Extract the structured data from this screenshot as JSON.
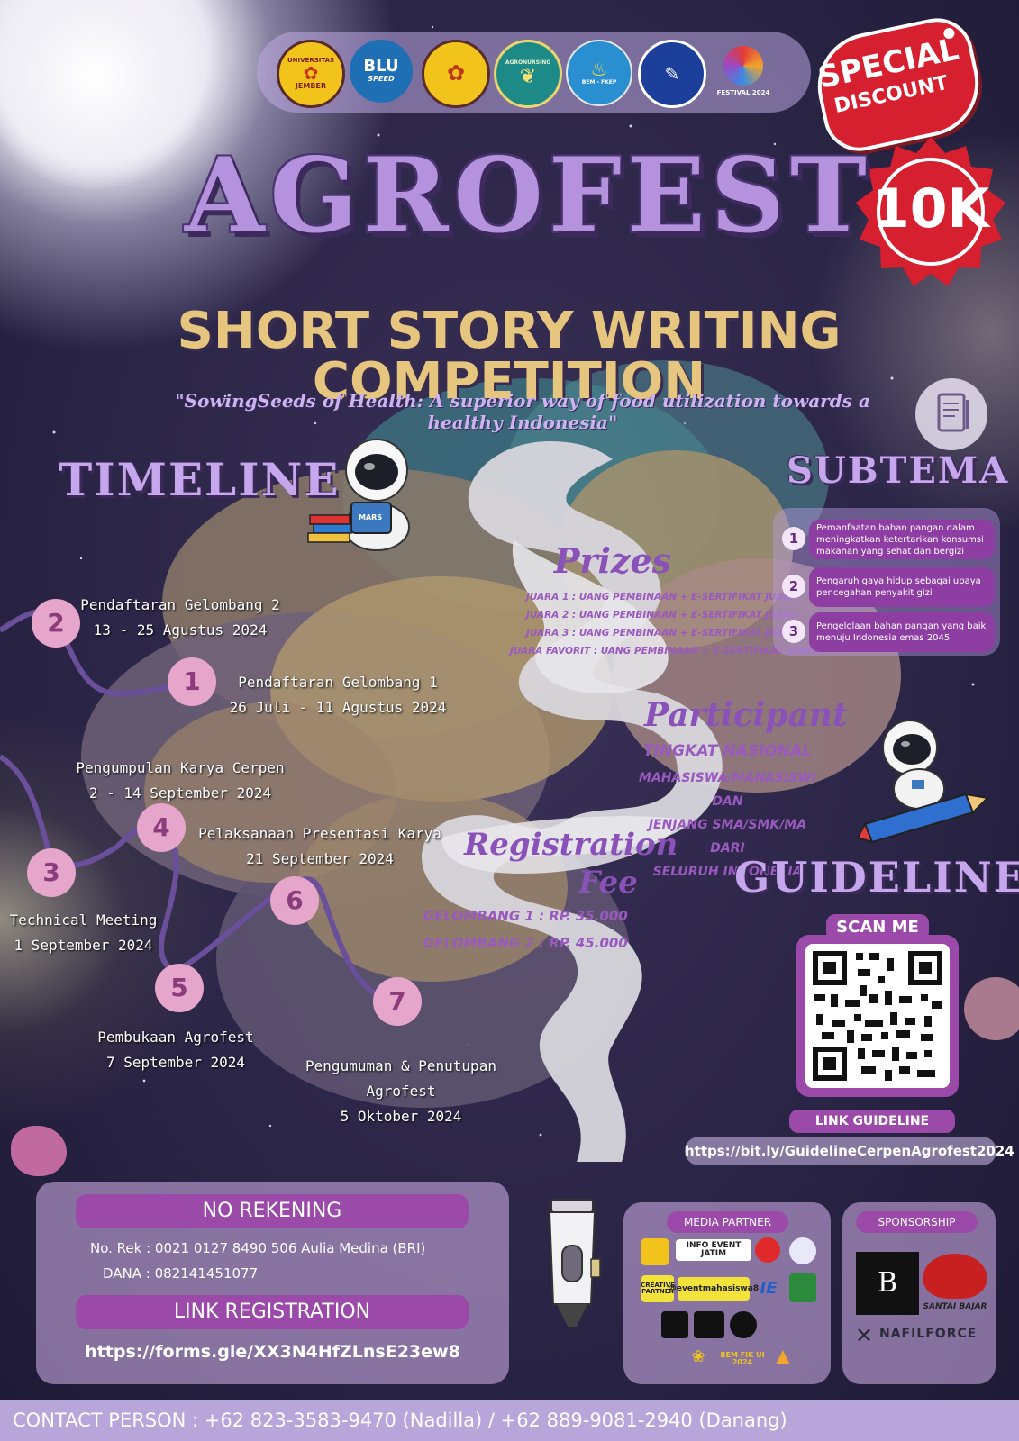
{
  "logos": {
    "univ_jember_top": "UNIVERSITAS",
    "univ_jember_bottom": "JEMBER",
    "blu_main": "BLU",
    "blu_sub": "SPEED",
    "agronursing_ring": "AGRONURSING",
    "bem_fkep": "BEM - FKEP",
    "festival": "FESTIVAL 2024"
  },
  "badge": {
    "special_line1": "SPECIAL",
    "special_line2": "DISCOUNT",
    "price": "10K"
  },
  "header": {
    "title": "AGROFEST",
    "subtitle": "SHORT STORY WRITING COMPETITION",
    "tagline": "\"SowingSeeds of Health: A superior way of food utilization towards a healthy Indonesia\""
  },
  "timeline": {
    "heading": "TIMELINE",
    "book_label": "MARS",
    "items": [
      {
        "num": "2",
        "title": "Pendaftaran Gelombang 2",
        "date": "13 - 25 Agustus 2024"
      },
      {
        "num": "1",
        "title": "Pendaftaran Gelombang 1",
        "date": "26 Juli - 11 Agustus 2024"
      },
      {
        "num": "",
        "title": "Pengumpulan Karya Cerpen",
        "date": "2 - 14 September 2024"
      },
      {
        "num": "4",
        "title": "Pelaksanaan Presentasi Karya",
        "date": "21 September 2024"
      },
      {
        "num": "3",
        "title": "Technical Meeting",
        "date": "1 September 2024"
      },
      {
        "num": "6",
        "title": "",
        "date": ""
      },
      {
        "num": "5",
        "title": "Pembukaan Agrofest",
        "date": "7 September 2024"
      },
      {
        "num": "7",
        "title": "Pengumuman & Penutupan",
        "title2": "Agrofest",
        "date": "5 Oktober 2024"
      }
    ]
  },
  "prizes": {
    "heading": "Prizes",
    "lines": [
      "JUARA 1 : UANG PEMBINAAN + E-SERTIFIKAT JUARA",
      "JUARA 2 : UANG PEMBINAAN + E-SERTIFIKAT JUARA",
      "JUARA 3 : UANG PEMBINAAN + E-SERTIFIKAT JUARA",
      "JUARA FAVORIT : UANG PEMBINAAN + E-SERTIFIKAT JUARA"
    ]
  },
  "participant": {
    "heading": "Participant",
    "level": "TINGKAT NASIONAL",
    "lines": [
      "MAHASISWA/MAHASISWI DAN",
      "JENJANG SMA/SMK/MA DARI",
      "SELURUH INDONESIA"
    ]
  },
  "registration_fee": {
    "heading_1": "Registration",
    "heading_2": "Fee",
    "wave1": "GELOMBANG 1 : RP. 35.000",
    "wave2": "GELOMBANG 2 : RP. 45.000"
  },
  "subtema": {
    "heading": "SUBTEMA",
    "items": [
      {
        "num": "1",
        "text": "Pemanfaatan bahan pangan dalam meningkatkan ketertarikan konsumsi makanan yang sehat dan bergizi"
      },
      {
        "num": "2",
        "text": "Pengaruh gaya hidup sebagai upaya pencegahan penyakit gizi"
      },
      {
        "num": "3",
        "text": "Pengelolaan bahan pangan yang baik menuju Indonesia emas 2045"
      }
    ]
  },
  "guideline": {
    "heading": "GUIDELINE",
    "scan_label": "SCAN ME",
    "link_label": "LINK GUIDELINE",
    "url": "https://bit.ly/GuidelineCerpenAgrofest2024"
  },
  "payment": {
    "heading": "NO REKENING",
    "rek": "No. Rek : 0021 0127 8490 506 Aulia Medina (BRI)",
    "dana": "DANA : 082141451077",
    "reg_heading": "LINK REGISTRATION",
    "reg_url": "https://forms.gle/XX3N4HfZLnsE23ew8"
  },
  "media_partner": {
    "heading": "MEDIA PARTNER",
    "logos": [
      "INFO EVENT JATIM",
      "CREATIVE PARTNER",
      "@eventmahasiswa8",
      "IE",
      "BEM FIK UI 2024"
    ]
  },
  "sponsorship": {
    "heading": "SPONSORSHIP",
    "logos": [
      "B",
      "SANTAI BAJAR",
      "NAFILFORCE"
    ]
  },
  "contact": {
    "text": "CONTACT PERSON :  +62 823-3583-9470 (Nadilla) / +62 889-9081-2940 (Danang)"
  },
  "colors": {
    "title_lilac": "#b592dd",
    "subtitle_gold": "#e6c57e",
    "badge_red": "#d6202f",
    "accent_purple": "#9b4aa9",
    "smoke": "#d8d6dc"
  }
}
